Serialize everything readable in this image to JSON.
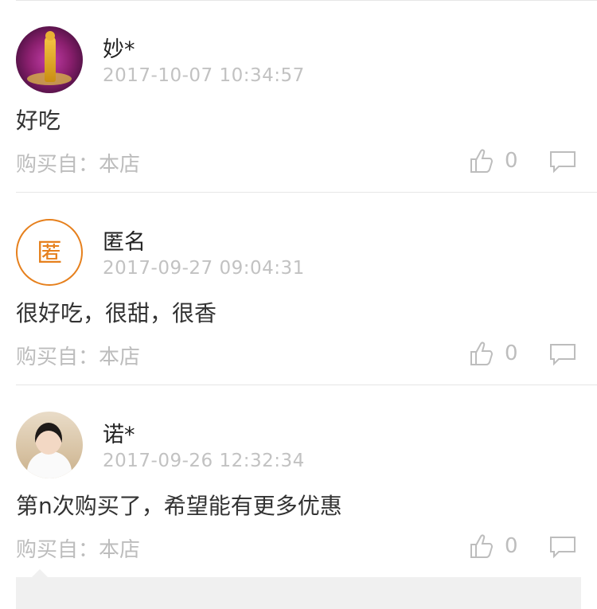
{
  "reviews": [
    {
      "user": "妙*",
      "time": "2017-10-07 10:34:57",
      "content": "好吃",
      "source": "购买自：本店",
      "likes": "0",
      "avatar": "buddha-photo"
    },
    {
      "user": "匿名",
      "time": "2017-09-27 09:04:31",
      "content": "很好吃，很甜，很香",
      "source": "购买自：本店",
      "likes": "0",
      "avatar": "anonymous-badge",
      "avatar_text": "匿"
    },
    {
      "user": "诺*",
      "time": "2017-09-26 12:32:34",
      "content": "第n次购买了，希望能有更多优惠",
      "source": "购买自：本店",
      "likes": "0",
      "avatar": "person-photo"
    }
  ],
  "colors": {
    "accent": "#e6801d",
    "muted": "#bdbdbd",
    "divider": "#e6e6e6"
  }
}
